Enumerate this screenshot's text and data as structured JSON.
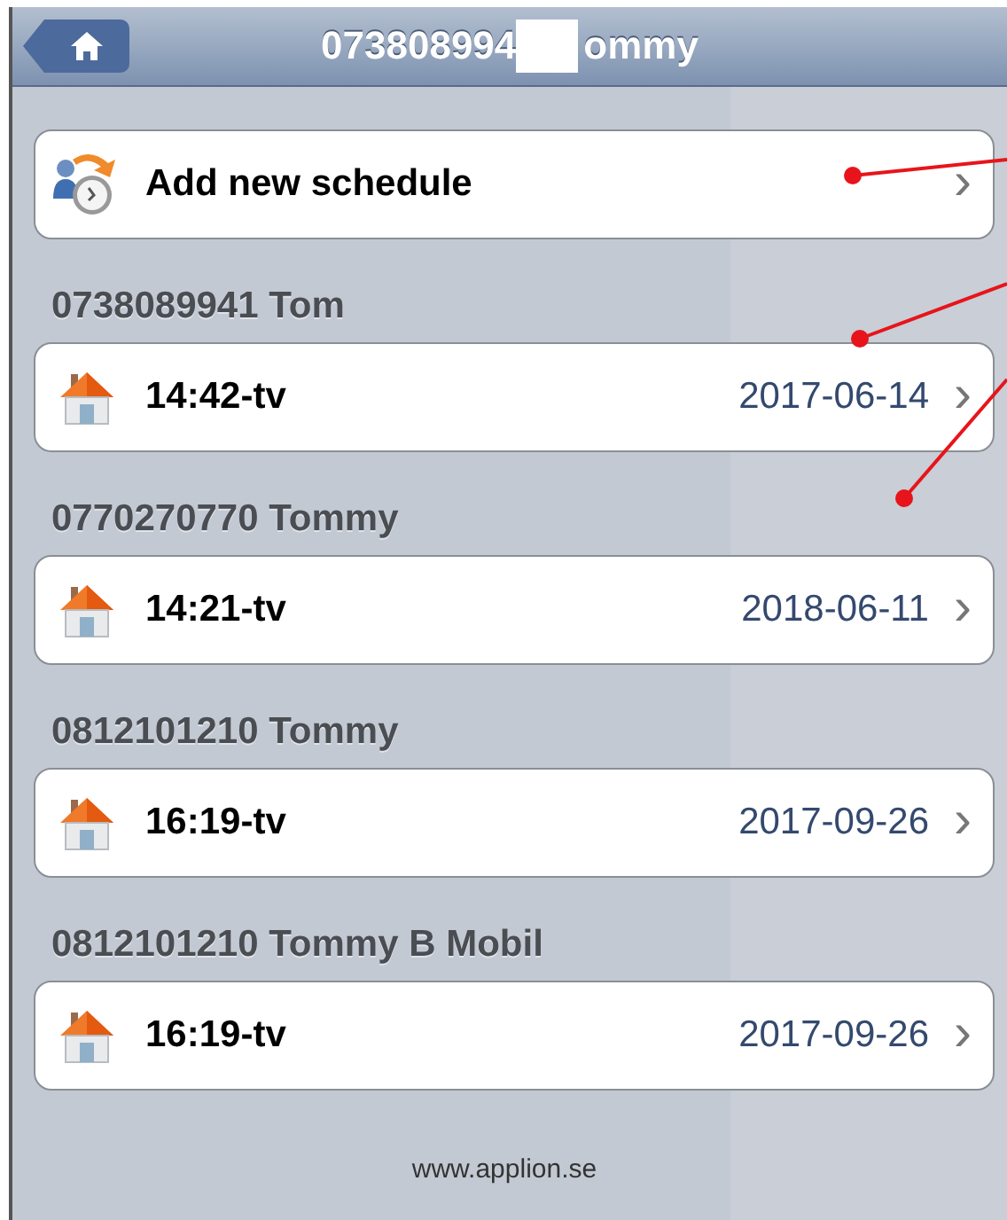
{
  "navbar": {
    "title_parts": [
      "073808994",
      "ommy"
    ]
  },
  "add_item": {
    "label": "Add new schedule",
    "chevron": "›"
  },
  "groups": [
    {
      "header": "0738089941 Tom",
      "items": [
        {
          "label": "14:42-tv",
          "date": "2017-06-14",
          "chevron": "›"
        }
      ]
    },
    {
      "header": "0770270770 Tommy",
      "items": [
        {
          "label": "14:21-tv",
          "date": "2018-06-11",
          "chevron": "›"
        }
      ]
    },
    {
      "header": "0812101210 Tommy",
      "items": [
        {
          "label": "16:19-tv",
          "date": "2017-09-26",
          "chevron": "›"
        }
      ]
    },
    {
      "header": "0812101210 Tommy B Mobil",
      "items": [
        {
          "label": "16:19-tv",
          "date": "2017-09-26",
          "chevron": "›"
        }
      ]
    }
  ],
  "footer": "www.applion.se",
  "annotations": [
    {
      "kind": "leader"
    },
    {
      "kind": "leader"
    },
    {
      "kind": "leader"
    }
  ]
}
